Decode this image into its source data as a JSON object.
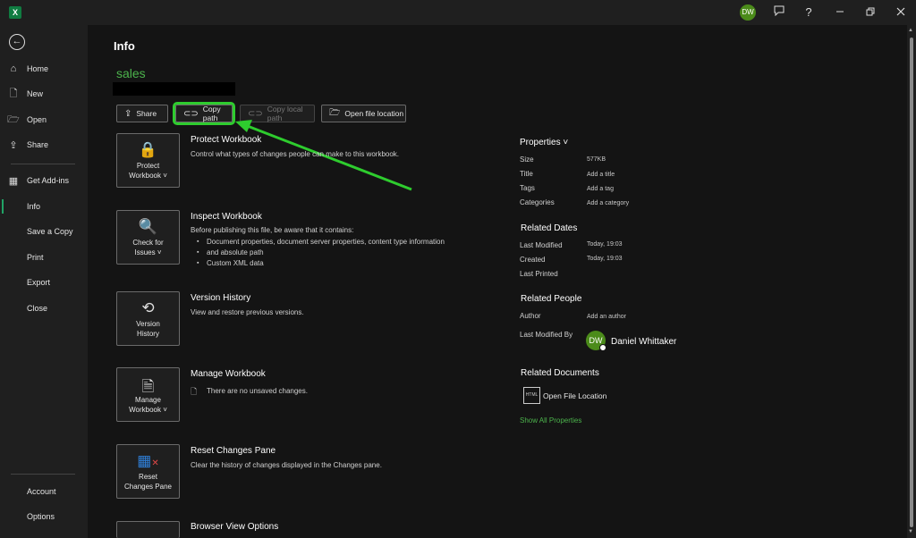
{
  "titlebar": {
    "app_icon": "excel-logo",
    "avatar_initials": "DW",
    "icons": [
      "feedback-icon",
      "help-icon",
      "minimize-icon",
      "restore-icon",
      "close-icon"
    ],
    "help_glyph": "?"
  },
  "sidebar": {
    "items": [
      {
        "label": "Home",
        "icon": "home-icon"
      },
      {
        "label": "New",
        "icon": "new-file-icon"
      },
      {
        "label": "Open",
        "icon": "open-folder-icon"
      },
      {
        "label": "Share",
        "icon": "share-icon"
      },
      {
        "label": "Get Add-ins",
        "icon": "add-ins-icon"
      },
      {
        "label": "Info",
        "active": true
      },
      {
        "label": "Save a Copy"
      },
      {
        "label": "Print"
      },
      {
        "label": "Export"
      },
      {
        "label": "Close"
      }
    ],
    "footer": [
      {
        "label": "Account"
      },
      {
        "label": "Options"
      }
    ]
  },
  "main": {
    "title": "Info",
    "file_name": "sales",
    "buttons": {
      "share": "Share",
      "copy_path": "Copy path",
      "copy_local_path": "Copy local path",
      "open_location": "Open file location"
    },
    "sections": [
      {
        "button": [
          "Protect",
          "Workbook ˅"
        ],
        "title": "Protect Workbook",
        "desc": "Control what types of changes people can make to this workbook."
      },
      {
        "button": [
          "Check for",
          "Issues ˅"
        ],
        "title": "Inspect Workbook",
        "desc": "Before publishing this file, be aware that it contains:",
        "bullets": [
          "Document properties, document server properties, content type information",
          "and absolute path",
          "Custom XML data"
        ]
      },
      {
        "button": [
          "Version",
          "History"
        ],
        "title": "Version History",
        "desc": "View and restore previous versions."
      },
      {
        "button": [
          "Manage",
          "Workbook ˅"
        ],
        "title": "Manage Workbook",
        "desc": "There are no unsaved changes."
      },
      {
        "button": [
          "Reset",
          "Changes Pane"
        ],
        "title": "Reset Changes Pane",
        "desc": "Clear the history of changes displayed in the Changes pane."
      },
      {
        "title": "Browser View Options"
      }
    ]
  },
  "properties": {
    "header": "Properties ˅",
    "rows": [
      {
        "label": "Size",
        "value": "577KB"
      },
      {
        "label": "Title",
        "value": "Add a title"
      },
      {
        "label": "Tags",
        "value": "Add a tag"
      },
      {
        "label": "Categories",
        "value": "Add a category"
      }
    ],
    "dates_header": "Related Dates",
    "dates": [
      {
        "label": "Last Modified",
        "value": "Today, 19:03"
      },
      {
        "label": "Created",
        "value": "Today, 19:03"
      },
      {
        "label": "Last Printed",
        "value": ""
      }
    ],
    "people_header": "Related People",
    "author_label": "Author",
    "author_value": "Add an author",
    "last_modified_by_label": "Last Modified By",
    "modifier_initials": "DW",
    "modifier_name": "Daniel Whittaker",
    "documents_header": "Related Documents",
    "open_location": "Open File Location",
    "html_badge": "HTML",
    "show_all": "Show All Properties"
  },
  "annotation_color": "#2ecc2e"
}
